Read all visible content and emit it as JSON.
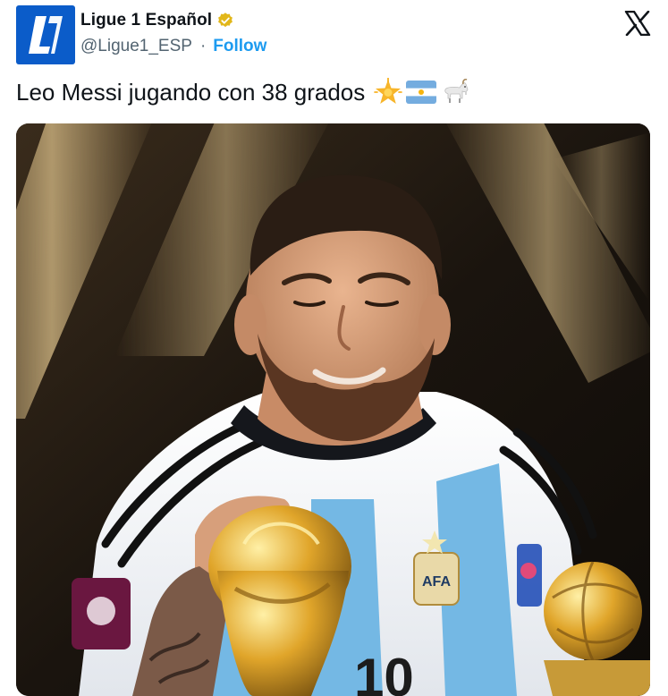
{
  "tweet": {
    "account": {
      "display_name": "Ligue 1 Español",
      "handle": "@Ligue1_ESP",
      "verified": true,
      "avatar_icon": "ligue1-logo",
      "avatar_color": "#0b5cc9"
    },
    "follow_label": "Follow",
    "separator": "·",
    "text": "Leo Messi jugando con 38 grados",
    "emojis": [
      "star-emoji",
      "argentina-flag-emoji",
      "goat-emoji"
    ],
    "platform_icon": "x-logo-icon",
    "media": {
      "type": "photo",
      "colors": {
        "follow": "#1d9bf0",
        "handle": "#536471",
        "text": "#0f1419"
      }
    }
  }
}
